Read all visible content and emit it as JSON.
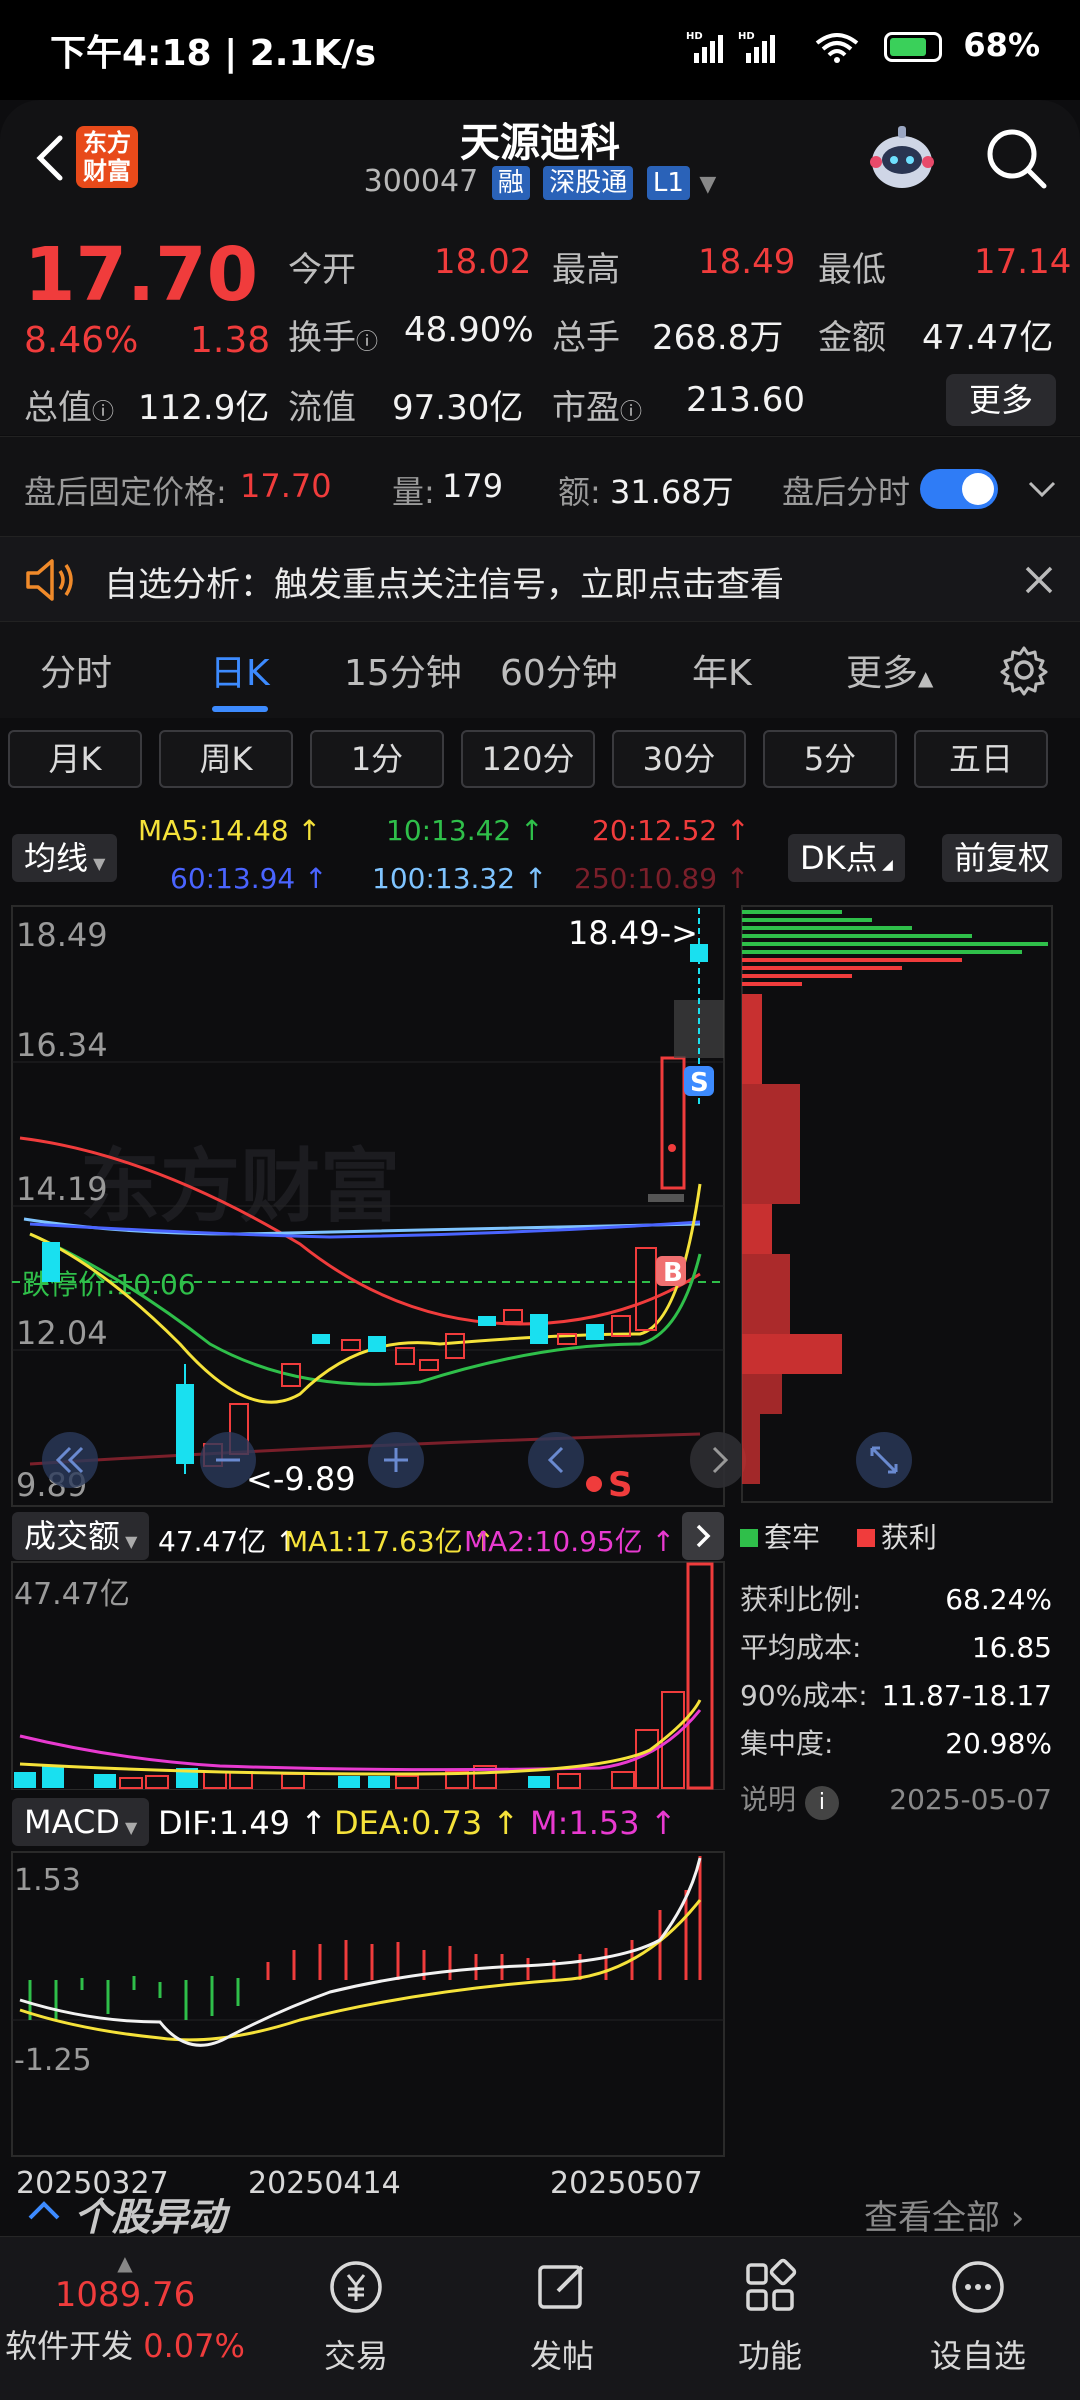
{
  "status_bar": {
    "time": "下午4:18 | 2.1K/s",
    "battery": "68%"
  },
  "header": {
    "title": "天源迪科",
    "code": "300047",
    "tags": [
      "融",
      "深股通",
      "L1"
    ],
    "logo": "东方\n财富"
  },
  "quote": {
    "price": "17.70",
    "change_pct": "8.46%",
    "change": "1.38",
    "rows": [
      [
        {
          "label": "今开",
          "value": "18.02",
          "color": "#f03c3c"
        },
        {
          "label": "最高",
          "value": "18.49",
          "color": "#f03c3c"
        },
        {
          "label": "最低",
          "value": "17.14",
          "color": "#f03c3c"
        }
      ],
      [
        {
          "label": "换手",
          "value": "48.90%",
          "color": "#f2f2f2"
        },
        {
          "label": "总手",
          "value": "268.8万",
          "color": "#f2f2f2"
        },
        {
          "label": "金额",
          "value": "47.47亿",
          "color": "#f2f2f2"
        }
      ],
      [
        {
          "label": "总值",
          "value": "112.9亿",
          "color": "#f2f2f2"
        },
        {
          "label": "流值",
          "value": "97.30亿",
          "color": "#f2f2f2"
        },
        {
          "label": "市盈",
          "value": "213.60",
          "color": "#f2f2f2"
        }
      ]
    ],
    "more_label": "更多"
  },
  "after_hours": {
    "label": "盘后固定价格:",
    "price": "17.70",
    "vol_label": "量:",
    "vol": "179",
    "amt_label": "额:",
    "amt": "31.68万",
    "toggle_label": "盘后分时"
  },
  "alert": {
    "text": "自选分析：触发重点关注信号，立即点击查看"
  },
  "tabs": [
    "分时",
    "日K",
    "15分钟",
    "60分钟",
    "年K",
    "更多"
  ],
  "active_tab": "日K",
  "sub_tabs": [
    "月K",
    "周K",
    "1分",
    "120分",
    "30分",
    "5分",
    "五日"
  ],
  "ma_legend": {
    "button": "均线",
    "items": [
      {
        "text": "MA5:14.48 ↑",
        "color": "#f5e23a"
      },
      {
        "text": "10:13.42 ↑",
        "color": "#2fbf4a"
      },
      {
        "text": "20:12.52 ↑",
        "color": "#f03c3c"
      },
      {
        "text": "60:13.94 ↑",
        "color": "#4a64ff"
      },
      {
        "text": "100:13.32 ↑",
        "color": "#7fc4ff"
      },
      {
        "text": "250:10.89 ↑",
        "color": "#7a1f2a"
      }
    ],
    "dk_button": "DK点",
    "adjust_button": "前复权"
  },
  "kline": {
    "y_labels": [
      "18.49",
      "16.34",
      "14.19",
      "12.04",
      "9.89"
    ],
    "high_label": "18.49->",
    "low_label": "<-9.89",
    "limit_down_label": "跌停价:10.06",
    "watermark": "东方财富",
    "b_marker": "B",
    "s_marker": "S"
  },
  "chips_legend": {
    "trapped": "套牢",
    "profit": "获利"
  },
  "chips_stats": [
    {
      "label": "获利比例:",
      "value": "68.24%"
    },
    {
      "label": "平均成本:",
      "value": "16.85"
    },
    {
      "label": "90%成本:",
      "value": "11.87-18.17"
    },
    {
      "label": "集中度:",
      "value": "20.98%"
    }
  ],
  "chips_footer": {
    "label": "说明",
    "date": "2025-05-07"
  },
  "volume": {
    "button": "成交额",
    "value": "47.47亿 ↑",
    "ma1": "MA1:17.63亿 ↑",
    "ma2": "MA2:10.95亿 ↑",
    "max_label": "47.47亿"
  },
  "macd": {
    "button": "MACD",
    "dif": "DIF:1.49 ↑",
    "dea": "DEA:0.73 ↑",
    "m": "M:1.53 ↑",
    "y_top": "1.53",
    "y_bottom": "-1.25"
  },
  "dates": [
    "20250327",
    "20250414",
    "20250507"
  ],
  "movement": {
    "title": "个股异动",
    "view_all": "查看全部"
  },
  "bottom_nav": {
    "index_value": "1089.76",
    "index_name": "软件开发",
    "index_pct": "0.07%",
    "items": [
      "交易",
      "发帖",
      "功能",
      "设自选"
    ]
  }
}
